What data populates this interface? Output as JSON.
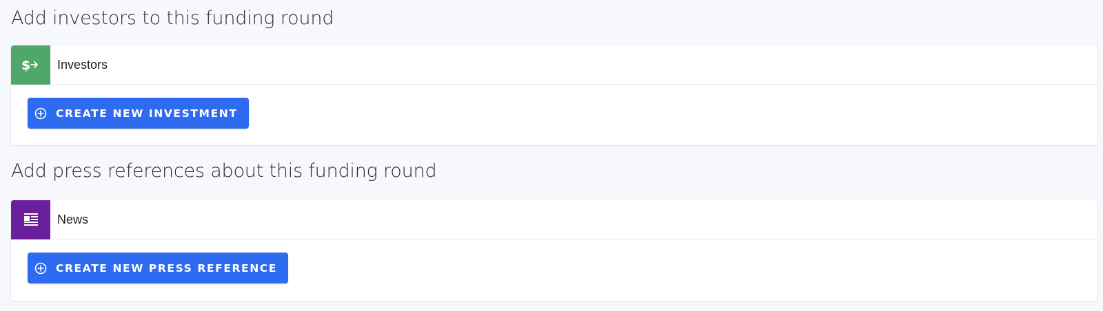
{
  "sections": {
    "investors": {
      "title": "Add investors to this funding round",
      "card": {
        "label": "Investors",
        "icon": "dollar-arrow-icon",
        "icon_color": "#4ea86a",
        "button_label": "CREATE NEW INVESTMENT",
        "button_icon": "plus-circle-icon"
      }
    },
    "press": {
      "title": "Add press references about this funding round",
      "card": {
        "label": "News",
        "icon": "newspaper-icon",
        "icon_color": "#6a1f9c",
        "button_label": "CREATE NEW PRESS REFERENCE",
        "button_icon": "plus-circle-icon"
      }
    }
  },
  "colors": {
    "background": "#f7f8fb",
    "primary_button": "#2f6bf0",
    "card": "#ffffff"
  }
}
